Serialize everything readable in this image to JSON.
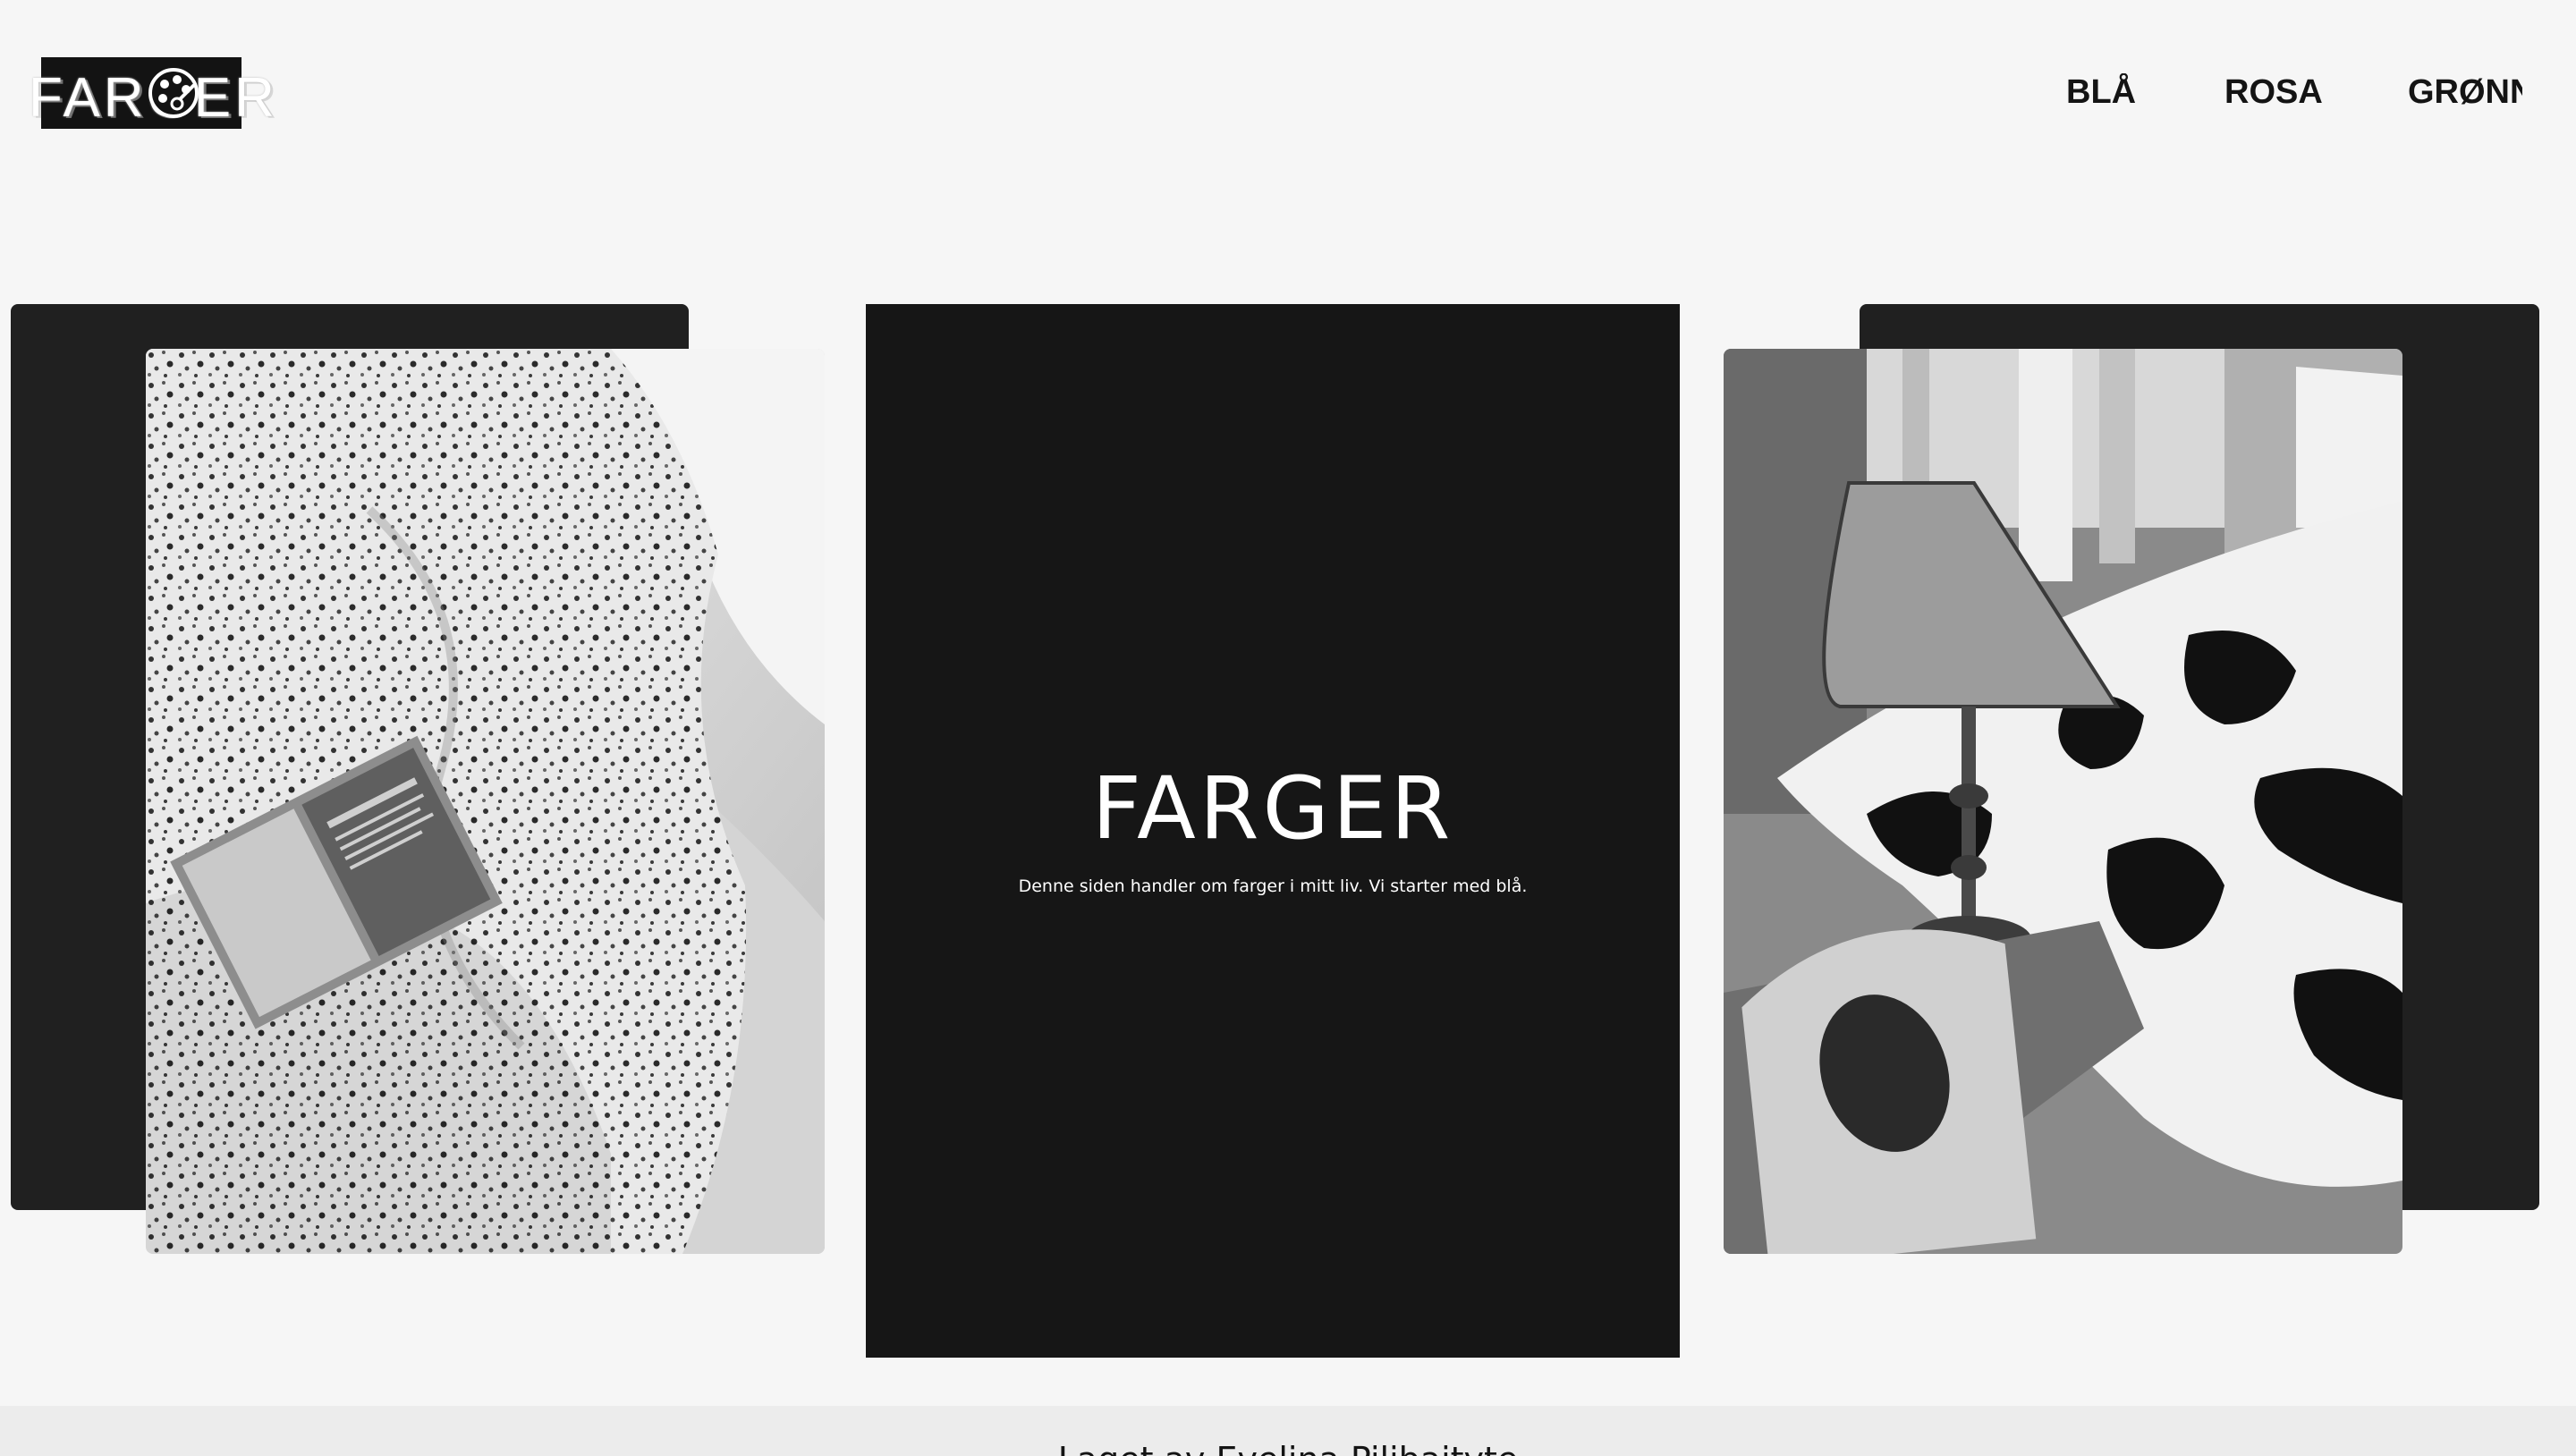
{
  "header": {
    "logo_text": "FARGER"
  },
  "nav": {
    "items": [
      {
        "label": "BLÅ"
      },
      {
        "label": "ROSA"
      },
      {
        "label": "GRØNN"
      }
    ]
  },
  "hero": {
    "title": "FARGER",
    "subtitle": "Denne siden handler om farger i mitt liv. Vi starter med blå."
  },
  "photos": {
    "left_icon": "bedding-book-photo",
    "right_icon": "bedroom-lamp-photo"
  },
  "colors": {
    "page_background": "#f6f6f6",
    "card_dark": "#202020",
    "hero_background": "#161616",
    "text_dark": "#141414",
    "text_light": "#ffffff"
  },
  "footer": {
    "credit": "Laget av Evelina Pilibaityte"
  }
}
